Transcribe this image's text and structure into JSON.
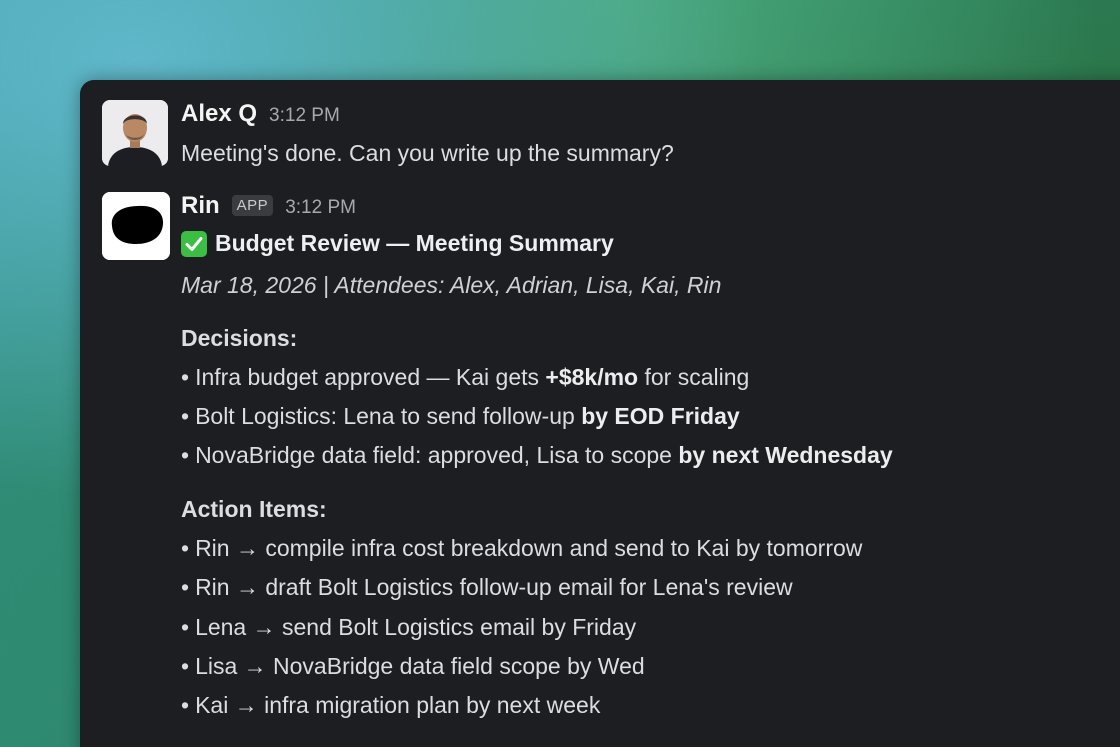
{
  "messages": {
    "alex": {
      "sender": "Alex Q",
      "time": "3:12 PM",
      "text": "Meeting's done. Can you write up the summary?"
    },
    "rin": {
      "sender": "Rin",
      "badge": "APP",
      "time": "3:12 PM",
      "title_icon": "check-mark-icon",
      "title": "Budget Review — Meeting Summary",
      "meta": "Mar 18, 2026 | Attendees: Alex, Adrian, Lisa, Kai, Rin",
      "decisions_heading": "Decisions:",
      "decisions": [
        {
          "bullet": "•",
          "pre": "Infra budget approved — Kai gets ",
          "bold": "+$8k/mo",
          "post": " for scaling"
        },
        {
          "bullet": "•",
          "pre": "Bolt Logistics: Lena to send follow-up ",
          "bold": "by EOD Friday",
          "post": ""
        },
        {
          "bullet": "•",
          "pre": "NovaBridge data field: approved, Lisa to scope ",
          "bold": "by next Wednesday",
          "post": ""
        }
      ],
      "actions_heading": "Action Items:",
      "actions": [
        {
          "bullet": "•",
          "text": "Rin → compile infra cost breakdown and send to Kai by tomorrow"
        },
        {
          "bullet": "•",
          "text": "Rin → draft Bolt Logistics follow-up email for Lena's review"
        },
        {
          "bullet": "•",
          "text": "Lena → send Bolt Logistics email by Friday"
        },
        {
          "bullet": "•",
          "text": "Lisa → NovaBridge data field scope by Wed"
        },
        {
          "bullet": "•",
          "text": "Kai → infra migration plan by next week"
        }
      ]
    }
  },
  "colors": {
    "window_bg": "#1d1e21",
    "check_green": "#3cbd44"
  }
}
